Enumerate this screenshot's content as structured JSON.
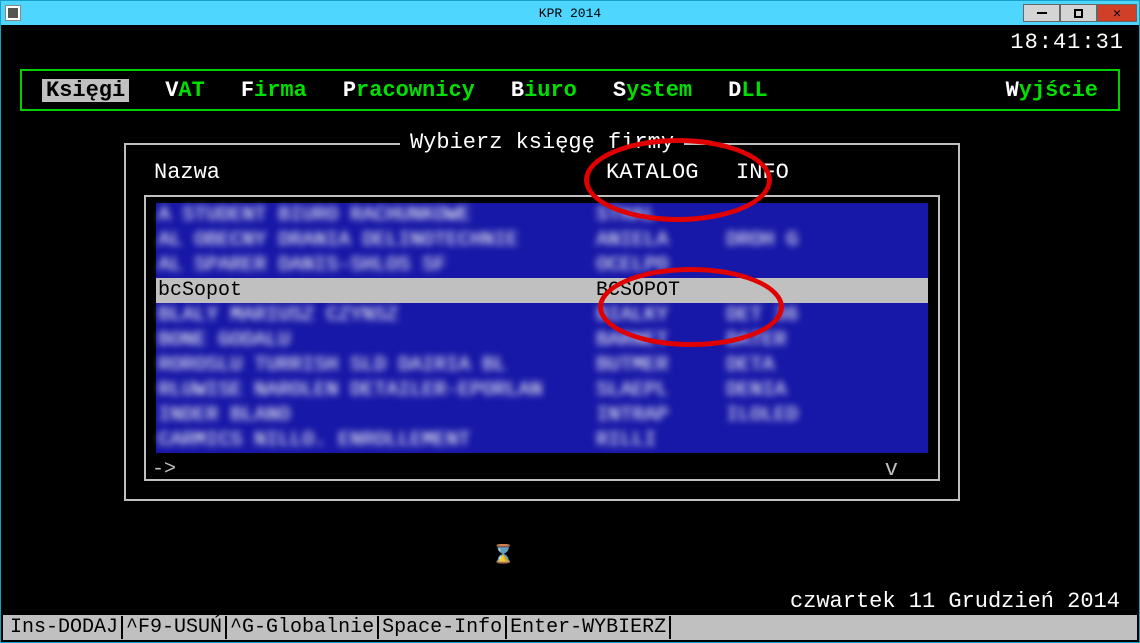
{
  "window": {
    "title": "KPR 2014"
  },
  "clock": "18:41:31",
  "menu": {
    "items": [
      {
        "hl": "K",
        "rest": "sięgi",
        "active": true
      },
      {
        "hl": "V",
        "rest": "AT"
      },
      {
        "hl": "F",
        "rest": "irma"
      },
      {
        "hl": "P",
        "rest": "racownicy"
      },
      {
        "hl": "B",
        "rest": "iuro"
      },
      {
        "hl": "S",
        "rest": "ystem"
      },
      {
        "hl": "D",
        "rest": "LL"
      }
    ],
    "exit": {
      "hl": "W",
      "rest": "yjście"
    }
  },
  "dialog": {
    "title": "Wybierz księgę firmy",
    "col1": "Nazwa",
    "col2": "KATALOG",
    "col3": "INFO",
    "rows": [
      {
        "name": "A STUDENT BIURO RACHUNKOWE",
        "kat": "STHAL",
        "info": "",
        "sel": false
      },
      {
        "name": "AL OBECNY DRANIA DELINOTECHNIE",
        "kat": "ANIELA",
        "info": "DROH G",
        "sel": false
      },
      {
        "name": "AL SPARER DANIS-SHLOS SF",
        "kat": "OCELPO",
        "info": "",
        "sel": false
      },
      {
        "name": "bcSopot",
        "kat": "BCSOPOT",
        "info": "",
        "sel": true
      },
      {
        "name": "BLALY MARIUSZ CZYNSZ",
        "kat": "BIALKY",
        "info": "DET 36",
        "sel": false
      },
      {
        "name": "BONE GODALU",
        "kat": "BARNET",
        "info": "DATER",
        "sel": false
      },
      {
        "name": "ROROSLU TURRISH SLD DAIRIA BL",
        "kat": "BUTMER",
        "info": "DETA",
        "sel": false
      },
      {
        "name": "RLUWISE NAROLEN DETAILER-EPORLAN",
        "kat": "SLAEPL",
        "info": "DENIA",
        "sel": false
      },
      {
        "name": "INDER BLANO",
        "kat": "INTRAP",
        "info": "ILOLED",
        "sel": false
      },
      {
        "name": "CARMICS NILLO. ENROLLEMENT",
        "kat": "RILLI",
        "info": "",
        "sel": false
      }
    ],
    "scroll_left": "->",
    "scroll_right": "v"
  },
  "footer": {
    "date": "czwartek  11 Grudzień  2014",
    "hints": [
      "Ins-DODAJ",
      "^F9-USUŃ",
      "^G-Globalnie",
      "Space-Info",
      "Enter-WYBIERZ"
    ]
  }
}
